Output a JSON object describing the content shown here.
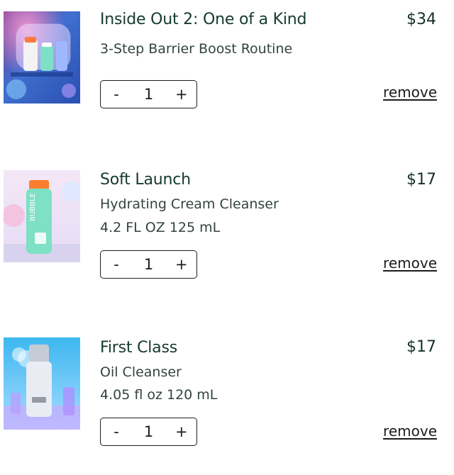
{
  "cart": {
    "items": [
      {
        "title": "Inside Out 2: One of a Kind",
        "subtitle": "3-Step Barrier Boost Routine",
        "size": "",
        "price": "$34",
        "quantity": "1",
        "minus_label": "-",
        "plus_label": "+",
        "remove_label": "remove"
      },
      {
        "title": "Soft Launch",
        "subtitle": "Hydrating Cream Cleanser",
        "size": "4.2 FL OZ 125 mL",
        "price": "$17",
        "quantity": "1",
        "minus_label": "-",
        "plus_label": "+",
        "remove_label": "remove"
      },
      {
        "title": "First Class",
        "subtitle": "Oil Cleanser",
        "size": "4.05 fl oz 120 mL",
        "price": "$17",
        "quantity": "1",
        "minus_label": "-",
        "plus_label": "+",
        "remove_label": "remove"
      }
    ]
  }
}
